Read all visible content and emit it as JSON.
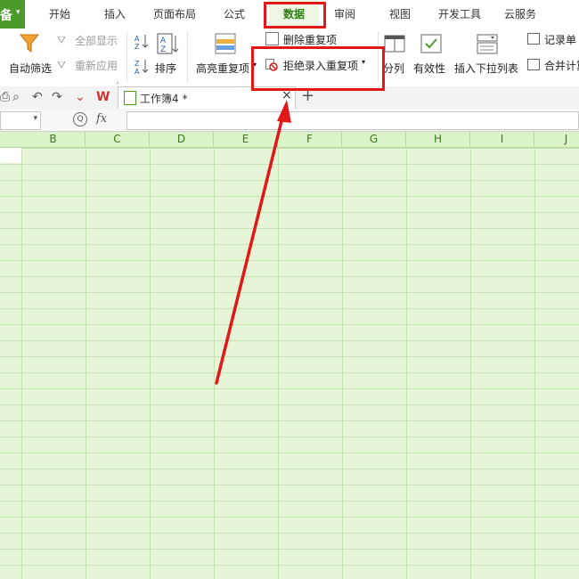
{
  "app_menu": {
    "label": "备",
    "arrow": "▾"
  },
  "tabs": [
    {
      "label": "开始"
    },
    {
      "label": "插入"
    },
    {
      "label": "页面布局"
    },
    {
      "label": "公式"
    },
    {
      "label": "数据"
    },
    {
      "label": "审阅"
    },
    {
      "label": "视图"
    },
    {
      "label": "开发工具"
    },
    {
      "label": "云服务"
    }
  ],
  "ribbon": {
    "auto_filter": "自动筛选",
    "show_all": "全部显示",
    "reapply": "重新应用",
    "sort": "排序",
    "highlight_dup": "高亮重复项",
    "delete_dup": "删除重复项",
    "reject_dup": "拒绝录入重复项",
    "split": "分列",
    "validity": "有效性",
    "insert_dropdown": "插入下拉列表",
    "record": "记录单",
    "consolidate": "合并计算"
  },
  "doc_tab": {
    "title": "工作簿4 *",
    "close": "×",
    "new": "+"
  },
  "formula": {
    "fx": "fx",
    "zoom": "Q"
  },
  "columns": [
    "B",
    "C",
    "D",
    "E",
    "F",
    "G",
    "H",
    "I",
    "J"
  ],
  "colors": {
    "accent": "#4c9a2a",
    "highlight": "#e01818",
    "grid_bg": "#e6f5d8"
  }
}
